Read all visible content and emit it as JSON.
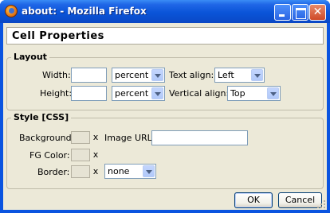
{
  "window": {
    "title": "about: - Mozilla Firefox",
    "close_glyph": "✕"
  },
  "dialog": {
    "heading": "Cell Properties"
  },
  "layout": {
    "legend": "Layout",
    "width_label": "Width:",
    "width_value": "",
    "width_unit": "percent",
    "height_label": "Height:",
    "height_value": "",
    "height_unit": "percent",
    "text_align_label": "Text align:",
    "text_align_value": "Left",
    "vertical_align_label": "Vertical align:",
    "vertical_align_value": "Top"
  },
  "style": {
    "legend": "Style [CSS]",
    "background_label": "Background:",
    "image_url_label": "Image URL:",
    "image_url_value": "",
    "fg_color_label": "FG Color:",
    "border_label": "Border:",
    "border_style_value": "none",
    "clear_glyph": "x"
  },
  "buttons": {
    "ok": "OK",
    "cancel": "Cancel"
  }
}
